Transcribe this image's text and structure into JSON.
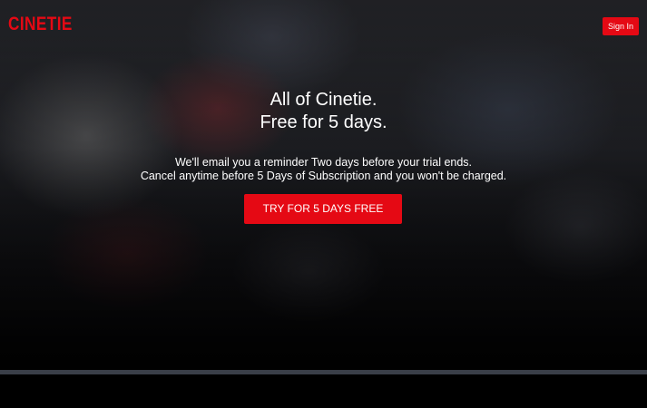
{
  "header": {
    "logo_text": "CINETIE",
    "signin_label": "Sign In"
  },
  "hero": {
    "headline_line1": "All of Cinetie.",
    "headline_line2": "Free for 5 days.",
    "sub_line1": "We'll email you a reminder Two days before your trial ends.",
    "sub_line2": "Cancel anytime before 5 Days of Subscription and you won't be charged.",
    "cta_label": "TRY FOR 5 DAYS FREE"
  },
  "colors": {
    "brand_red": "#e50914",
    "background": "#000000",
    "divider": "#3a3f48"
  }
}
